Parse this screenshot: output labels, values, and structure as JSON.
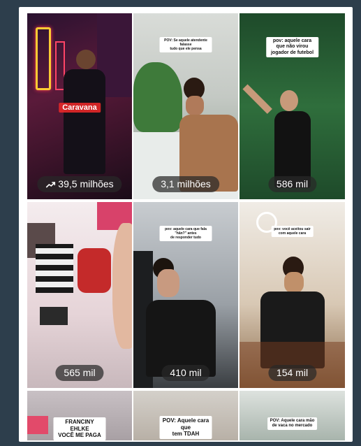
{
  "tiles": [
    {
      "caption": "",
      "overlay": "Caravana",
      "views": "39,5 milhões",
      "trending": true
    },
    {
      "caption": "POV: Se aquele atendente falasse\ntudo que ele pensa",
      "views": "3,1 milhões"
    },
    {
      "caption": "pov: aquele cara que não virou\njogador de futebol",
      "views": "586 mil"
    },
    {
      "caption": "",
      "views": "565 mil"
    },
    {
      "caption": "pov: aquele cara que fala \"hãn?\" antes\nde responder tudo",
      "views": "410 mil"
    },
    {
      "caption": "pov: você aceitou sair\ncom aquele cara",
      "views": "154 mil"
    },
    {
      "caption": "FRANCINY EHLKE\nVOCÊ ME PAGA"
    },
    {
      "caption": "POV: Aquele cara que\ntem TDAH"
    },
    {
      "caption": "POV: Aquele cara mão\nde vaca no mercado"
    }
  ]
}
